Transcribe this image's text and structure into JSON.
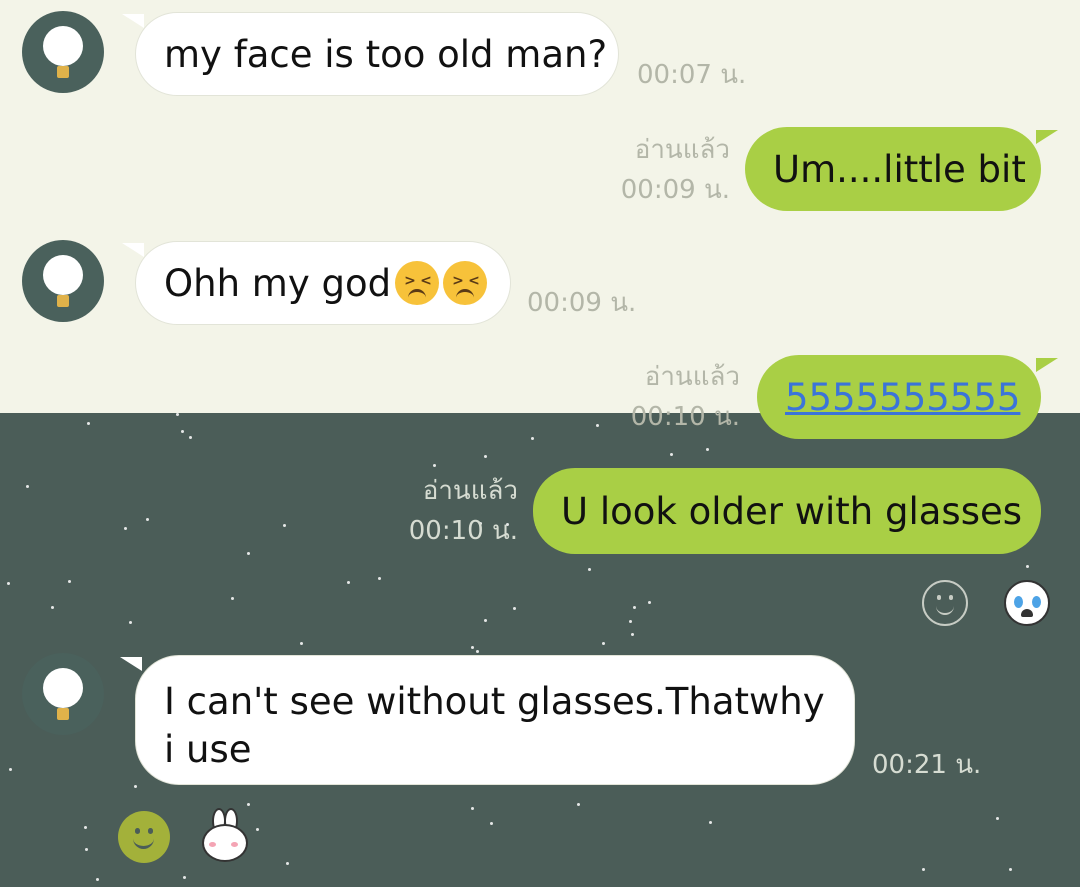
{
  "messages": [
    {
      "id": "m1",
      "direction": "in",
      "text": "my face is too old man?",
      "time": "00:07 น."
    },
    {
      "id": "m2",
      "direction": "out",
      "text": "Um....little bit",
      "read": "อ่านแล้ว",
      "time": "00:09 น."
    },
    {
      "id": "m3",
      "direction": "in",
      "text": "Ohh my god",
      "emoji": [
        "persevering-face",
        "persevering-face"
      ],
      "time": "00:09 น."
    },
    {
      "id": "m4",
      "direction": "out",
      "text": "5555555555",
      "is_link": true,
      "read": "อ่านแล้ว",
      "time": "00:10 น."
    },
    {
      "id": "m5",
      "direction": "out",
      "text": "U look older with glasses",
      "read": "อ่านแล้ว",
      "time": "00:10 น."
    },
    {
      "id": "m6",
      "direction": "in",
      "text": "I can't see without glasses.Thatwhy i use",
      "time": "00:21 น."
    }
  ],
  "reactions": {
    "after_m5": [
      "smiley-outline-icon",
      "crying-face-icon"
    ],
    "after_m6": [
      "smiley-green-icon",
      "cony-sticker-icon"
    ]
  },
  "colors": {
    "top_background": "#f3f4e8",
    "bottom_background": "#4b5d58",
    "incoming_bubble": "#ffffff",
    "outgoing_bubble": "#a9cf45",
    "link": "#3b74d9",
    "avatar": "#4a615c"
  }
}
